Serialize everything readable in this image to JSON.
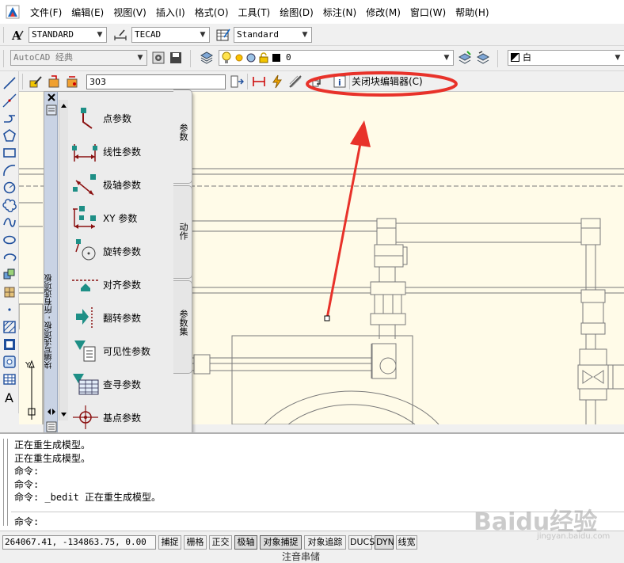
{
  "menu": [
    "文件(F)",
    "编辑(E)",
    "视图(V)",
    "插入(I)",
    "格式(O)",
    "工具(T)",
    "绘图(D)",
    "标注(N)",
    "修改(M)",
    "窗口(W)",
    "帮助(H)"
  ],
  "styles_toolbar": {
    "text_style": "STANDARD",
    "dim_style": "TECAD",
    "table_style": "Standard"
  },
  "workspace": "AutoCAD 经典",
  "layer": {
    "name": "0"
  },
  "color_control": "白",
  "block_editor": {
    "block_name": "303",
    "close_label": "关闭块编辑器(C)"
  },
  "palette": {
    "title": "块编写选项板 - 所有选项板",
    "tabs": [
      "参数",
      "动作",
      "参数集"
    ],
    "items": [
      "点参数",
      "线性参数",
      "极轴参数",
      "XY 参数",
      "旋转参数",
      "对齐参数",
      "翻转参数",
      "可见性参数",
      "查寻参数",
      "基点参数"
    ]
  },
  "command_history": [
    "正在重生成模型。",
    "正在重生成模型。",
    "命令:",
    "命令:",
    "命令: _bedit 正在重生成模型。"
  ],
  "command_prompt": "命令:",
  "status": {
    "coords": "264067.41, -134863.75, 0.00",
    "toggles": [
      "捕捉",
      "栅格",
      "正交",
      "极轴",
      "对象捕捉",
      "对象追踪",
      "DUCS",
      "DYN",
      "线宽"
    ],
    "below_text": "注音串储"
  },
  "watermark": {
    "main": "Baidu经验",
    "sub": "jingyan.baidu.com"
  },
  "colors": {
    "drawing_bg": "#fffbe8",
    "annotation": "#e8322a",
    "palette_title": "#c9d3e4"
  }
}
